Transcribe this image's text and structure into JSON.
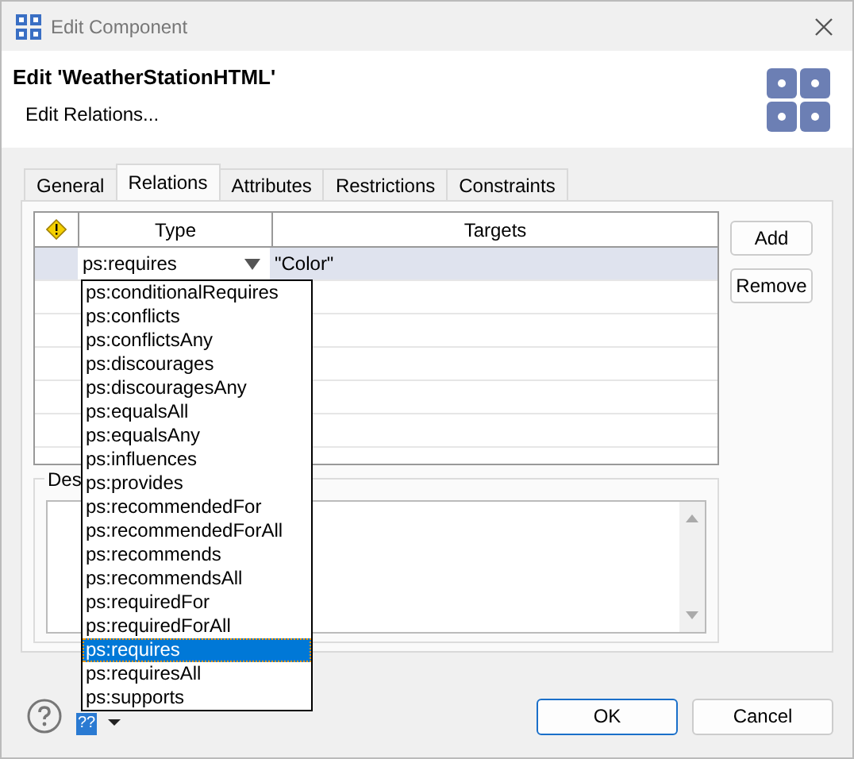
{
  "window": {
    "title": "Edit Component"
  },
  "header": {
    "title": "Edit 'WeatherStationHTML'",
    "subtitle": "Edit Relations..."
  },
  "tabs": [
    {
      "label": "General",
      "selected": false
    },
    {
      "label": "Relations",
      "selected": true
    },
    {
      "label": "Attributes",
      "selected": false
    },
    {
      "label": "Restrictions",
      "selected": false
    },
    {
      "label": "Constraints",
      "selected": false
    }
  ],
  "table": {
    "columns": [
      "Type",
      "Targets"
    ],
    "rows": [
      {
        "type": "ps:requires",
        "targets": "\"Color\"",
        "selected": true
      }
    ]
  },
  "dropdown": {
    "options": [
      {
        "label": "ps:conditionalRequires",
        "selected": false
      },
      {
        "label": "ps:conflicts",
        "selected": false
      },
      {
        "label": "ps:conflictsAny",
        "selected": false
      },
      {
        "label": "ps:discourages",
        "selected": false
      },
      {
        "label": "ps:discouragesAny",
        "selected": false
      },
      {
        "label": "ps:equalsAll",
        "selected": false
      },
      {
        "label": "ps:equalsAny",
        "selected": false
      },
      {
        "label": "ps:influences",
        "selected": false
      },
      {
        "label": "ps:provides",
        "selected": false
      },
      {
        "label": "ps:recommendedFor",
        "selected": false
      },
      {
        "label": "ps:recommendedForAll",
        "selected": false
      },
      {
        "label": "ps:recommends",
        "selected": false
      },
      {
        "label": "ps:recommendsAll",
        "selected": false
      },
      {
        "label": "ps:requiredFor",
        "selected": false
      },
      {
        "label": "ps:requiredForAll",
        "selected": false
      },
      {
        "label": "ps:requires",
        "selected": true
      },
      {
        "label": "ps:requiresAll",
        "selected": false
      },
      {
        "label": "ps:supports",
        "selected": false
      }
    ]
  },
  "side_buttons": [
    "Add",
    "Remove"
  ],
  "description": {
    "label": "Des"
  },
  "language_badge": "??",
  "buttons": [
    {
      "label": "OK",
      "default": true
    },
    {
      "label": "Cancel",
      "default": false
    }
  ]
}
